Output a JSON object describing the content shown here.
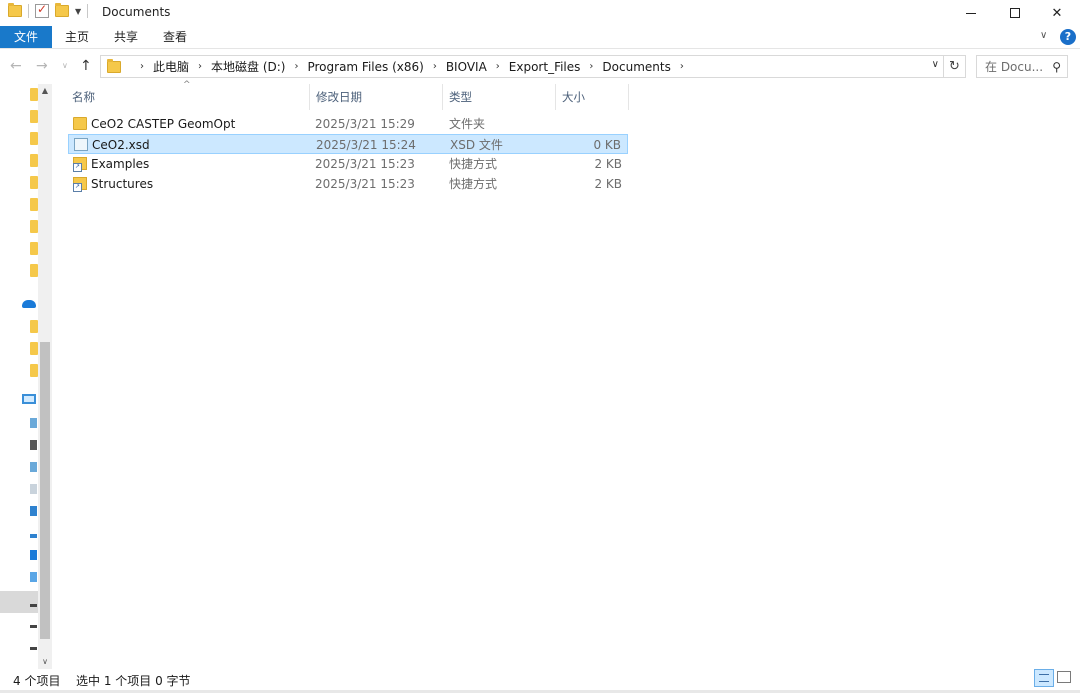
{
  "window": {
    "title": "Documents"
  },
  "ribbon": {
    "tabs": [
      {
        "label": "文件"
      },
      {
        "label": "主页"
      },
      {
        "label": "共享"
      },
      {
        "label": "查看"
      }
    ]
  },
  "address": {
    "breadcrumbs": [
      "此电脑",
      "本地磁盘 (D:)",
      "Program Files (x86)",
      "BIOVIA",
      "Export_Files",
      "Documents"
    ],
    "search_placeholder": "在 Docu..."
  },
  "columns": {
    "name": "名称",
    "date": "修改日期",
    "type": "类型",
    "size": "大小"
  },
  "files": [
    {
      "name": "CeO2 CASTEP GeomOpt",
      "date": "2025/3/21 15:29",
      "type": "文件夹",
      "size": "",
      "icon": "folder-icon",
      "selected": false
    },
    {
      "name": "CeO2.xsd",
      "date": "2025/3/21 15:24",
      "type": "XSD 文件",
      "size": "0 KB",
      "icon": "xsd-file-icon",
      "selected": true
    },
    {
      "name": "Examples",
      "date": "2025/3/21 15:23",
      "type": "快捷方式",
      "size": "2 KB",
      "icon": "shortcut-icon",
      "selected": false
    },
    {
      "name": "Structures",
      "date": "2025/3/21 15:23",
      "type": "快捷方式",
      "size": "2 KB",
      "icon": "shortcut-icon",
      "selected": false
    }
  ],
  "status": {
    "item_count": "4 个项目",
    "selection": "选中 1 个项目  0 字节"
  },
  "colors": {
    "accent": "#1979ca",
    "selection_bg": "#cce8ff",
    "selection_border": "#99d1ff",
    "folder": "#f5c84a"
  }
}
